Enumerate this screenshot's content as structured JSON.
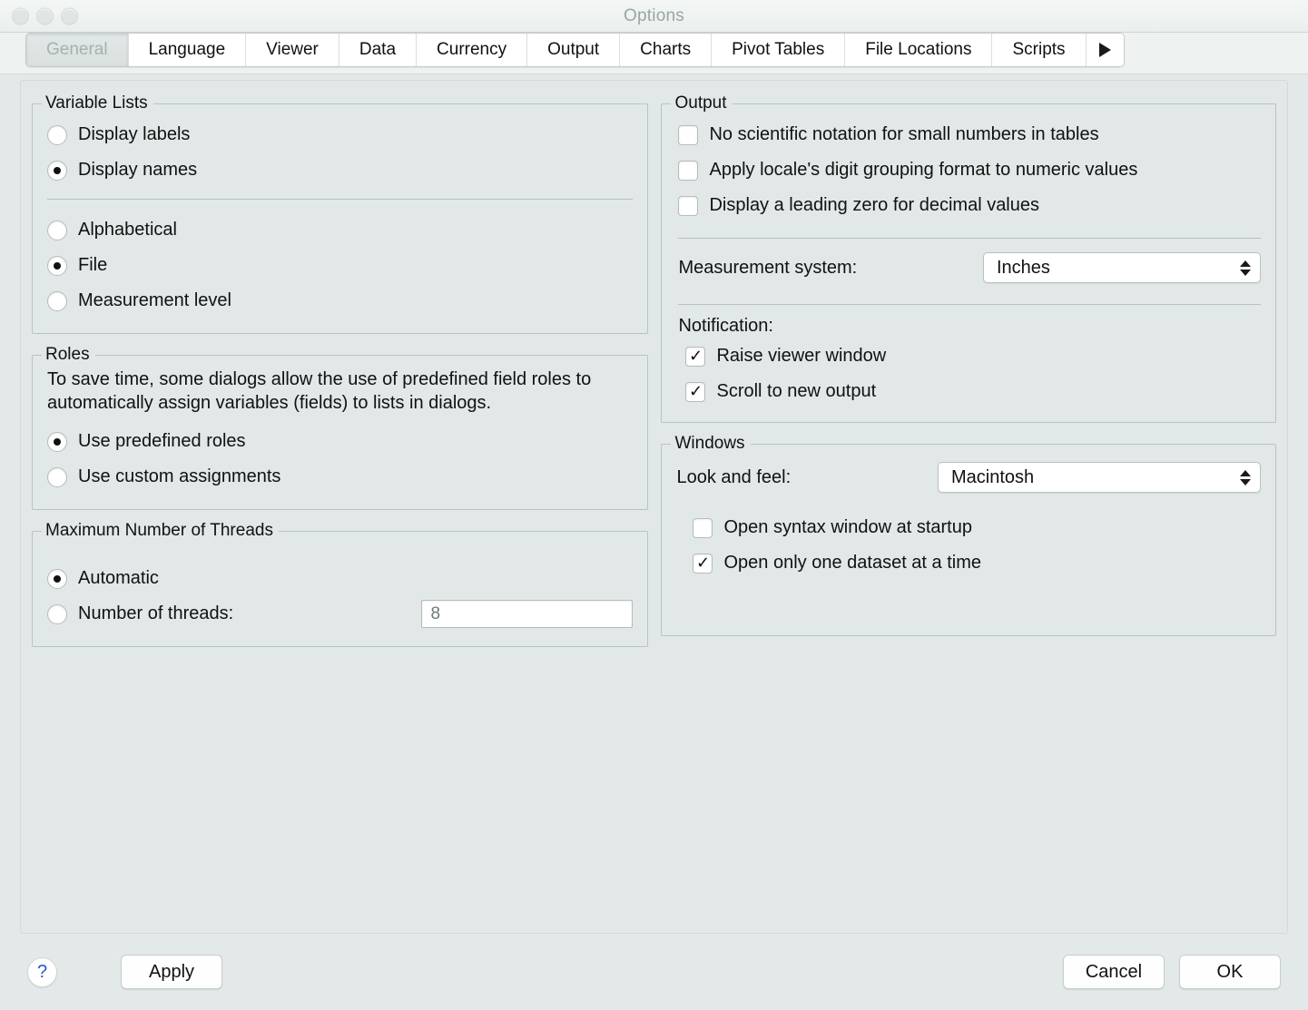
{
  "window": {
    "title": "Options",
    "traffic_lights": [
      "close-button",
      "minimize-button",
      "zoom-button"
    ]
  },
  "tabs": {
    "items": [
      {
        "label": "General",
        "selected": true
      },
      {
        "label": "Language",
        "selected": false
      },
      {
        "label": "Viewer",
        "selected": false
      },
      {
        "label": "Data",
        "selected": false
      },
      {
        "label": "Currency",
        "selected": false
      },
      {
        "label": "Output",
        "selected": false
      },
      {
        "label": "Charts",
        "selected": false
      },
      {
        "label": "Pivot Tables",
        "selected": false
      },
      {
        "label": "File Locations",
        "selected": false
      },
      {
        "label": "Scripts",
        "selected": false
      }
    ],
    "overflow_icon": "triangle-right-icon"
  },
  "variable_lists": {
    "title": "Variable Lists",
    "display_group": [
      {
        "label": "Display labels",
        "selected": false
      },
      {
        "label": "Display names",
        "selected": true
      }
    ],
    "order_group": [
      {
        "label": "Alphabetical",
        "selected": false
      },
      {
        "label": "File",
        "selected": true
      },
      {
        "label": "Measurement level",
        "selected": false
      }
    ]
  },
  "roles": {
    "title": "Roles",
    "description": "To save time, some dialogs allow the use of predefined field roles to automatically assign variables (fields) to lists in dialogs.",
    "options": [
      {
        "label": "Use predefined roles",
        "selected": true
      },
      {
        "label": "Use custom assignments",
        "selected": false
      }
    ]
  },
  "threads": {
    "title": "Maximum Number of Threads",
    "options": [
      {
        "label": "Automatic",
        "selected": true
      },
      {
        "label": "Number of threads:",
        "selected": false
      }
    ],
    "value": "8"
  },
  "output": {
    "title": "Output",
    "checkboxes": [
      {
        "label": "No scientific notation for small numbers in tables",
        "checked": false
      },
      {
        "label": "Apply locale's digit  grouping format to numeric values",
        "checked": false
      },
      {
        "label": "Display a leading zero for decimal values",
        "checked": false
      }
    ],
    "measurement_label": "Measurement system:",
    "measurement_value": "Inches",
    "notification_label": "Notification:",
    "notification_checkboxes": [
      {
        "label": "Raise viewer window",
        "checked": true
      },
      {
        "label": "Scroll to new output",
        "checked": true
      }
    ]
  },
  "windows": {
    "title": "Windows",
    "look_and_feel_label": "Look and feel:",
    "look_and_feel_value": "Macintosh",
    "checkboxes": [
      {
        "label": "Open syntax window at startup",
        "checked": false
      },
      {
        "label": "Open only one dataset at a time",
        "checked": true
      }
    ]
  },
  "footer": {
    "help_label": "?",
    "apply_label": "Apply",
    "cancel_label": "Cancel",
    "ok_label": "OK"
  },
  "colors": {
    "window_bg": "#e3e9e8",
    "content_bg": "#e1e8e7",
    "accent_blue": "#2a56c6",
    "text": "#111111",
    "muted_text": "#9aa6a4"
  }
}
